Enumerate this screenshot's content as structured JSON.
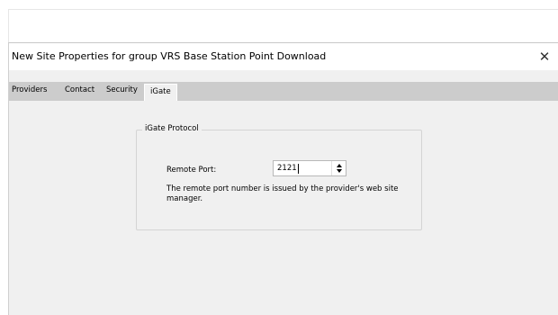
{
  "dialog": {
    "title": "New Site Properties for group VRS Base Station Point Download",
    "close_glyph": "✕"
  },
  "tabs": [
    {
      "label": "Providers",
      "active": false
    },
    {
      "label": "Contact",
      "active": false
    },
    {
      "label": "Security",
      "active": false
    },
    {
      "label": "iGate",
      "active": true
    }
  ],
  "group": {
    "legend": "iGate Protocol",
    "remote_port_label": "Remote Port:",
    "remote_port_value": "2121",
    "help_text": "The remote port number is issued by the provider's web site manager."
  },
  "icons": {
    "close": "close-icon",
    "spinner": "up-down-arrows-icon"
  }
}
